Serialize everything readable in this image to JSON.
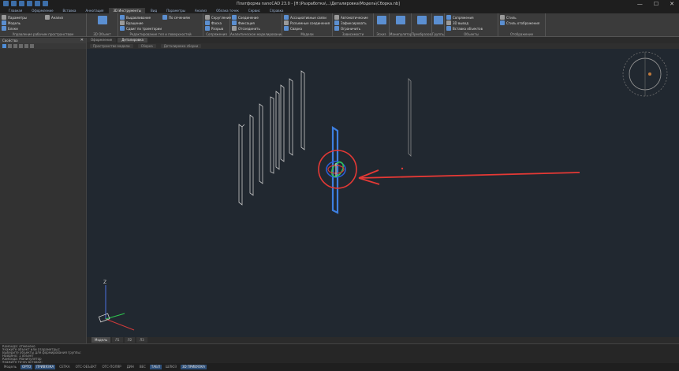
{
  "titlebar": {
    "title": "Платформа nanoCAD 23.0 - [Н:\\Разработка\\...\\Деталировка\\Модель\\Сборка.nb]",
    "window_controls": [
      "—",
      "☐",
      "✕"
    ]
  },
  "ribbon_tabs": [
    "Главная",
    "Оформление",
    "Вставка",
    "Аннотация",
    "3D Инструменты",
    "Вид",
    "Параметры",
    "Анализ",
    "Облака точек",
    "Сервис",
    "Справка"
  ],
  "ribbon_active_tab": 4,
  "ribbon": {
    "groups": [
      {
        "label": "Управление рабочим пространством",
        "buttons": [
          "Параметры",
          "Модель",
          "Блоки",
          "Анализ"
        ]
      },
      {
        "label": "3D Объект",
        "buttons": [
          "Сборка"
        ]
      },
      {
        "label": "Редактирование тел и поверхностей",
        "buttons": [
          "Выдавливание",
          "Вращение",
          "Сдвиг по траектории",
          "По сечениям"
        ]
      },
      {
        "label": "Сопряжения",
        "buttons": [
          "Скругление",
          "Фаска",
          "Разрыв"
        ]
      },
      {
        "label": "Аналитическое моделирование",
        "buttons": [
          "Соединение",
          "Фиксация",
          "Отсоединить"
        ]
      },
      {
        "label": "Модели",
        "buttons": [
          "Ассоциативные связи",
          "Разъемные соединения",
          "Сварка"
        ]
      },
      {
        "label": "Зависимости",
        "buttons": [
          "Автоматические",
          "Зафиксировать",
          "Ограничить"
        ]
      },
      {
        "label": "Эскиз",
        "buttons": [
          "Эскиз"
        ]
      },
      {
        "label": "Манипулятор",
        "buttons": [
          "Манипулятор"
        ]
      },
      {
        "label": "Преобразования",
        "buttons": [
          "Преобразования"
        ]
      },
      {
        "label": "Группы",
        "buttons": [
          "Группы"
        ]
      },
      {
        "label": "Объекты",
        "buttons": [
          "Сопряжения",
          "3D вывод",
          "Вставка объектов"
        ]
      },
      {
        "label": "Отображение",
        "buttons": [
          "Стиль",
          "Стиль отображения"
        ]
      }
    ]
  },
  "file_tabs": [
    "Оформление",
    "Деталировка"
  ],
  "file_tab_active": 1,
  "breadcrumbs": [
    "Пространство модели",
    "Сборка",
    "Деталировка сборки"
  ],
  "palette": {
    "title": "Свойства",
    "close": "✕"
  },
  "viewport": {
    "axis_labels": {
      "z": "Z",
      "y": "Y",
      "x": "X"
    },
    "highlight_color": "#e53935",
    "selection_color": "#3d7fe0"
  },
  "layout_tabs": [
    "Модель",
    "Л1",
    "Л2",
    "Л3"
  ],
  "layout_active": 0,
  "command_lines": [
    "Команда: отменено",
    "Укажите объект или [Параметры]:",
    "Выберите объекты для формирования группы:",
    "Найдено: 1 объект",
    "Команда: Манипулятор",
    "Укажите точку вставки:"
  ],
  "status_items": [
    {
      "label": "Модель",
      "on": false
    },
    {
      "label": "ОРТО",
      "on": true
    },
    {
      "label": "ПРИВЯЗКА",
      "on": true
    },
    {
      "label": "СЕТКА",
      "on": false
    },
    {
      "label": "ОТС-ОБЪЕКТ",
      "on": false
    },
    {
      "label": "ОТС-ПОЛЯР",
      "on": false
    },
    {
      "label": "ДИН",
      "on": false
    },
    {
      "label": "ВЕС",
      "on": false
    },
    {
      "label": "ТАБЛ",
      "on": true
    },
    {
      "label": "ШЛЮЗ",
      "on": false
    },
    {
      "label": "3D ПРИВЯЗКА",
      "on": true
    }
  ]
}
